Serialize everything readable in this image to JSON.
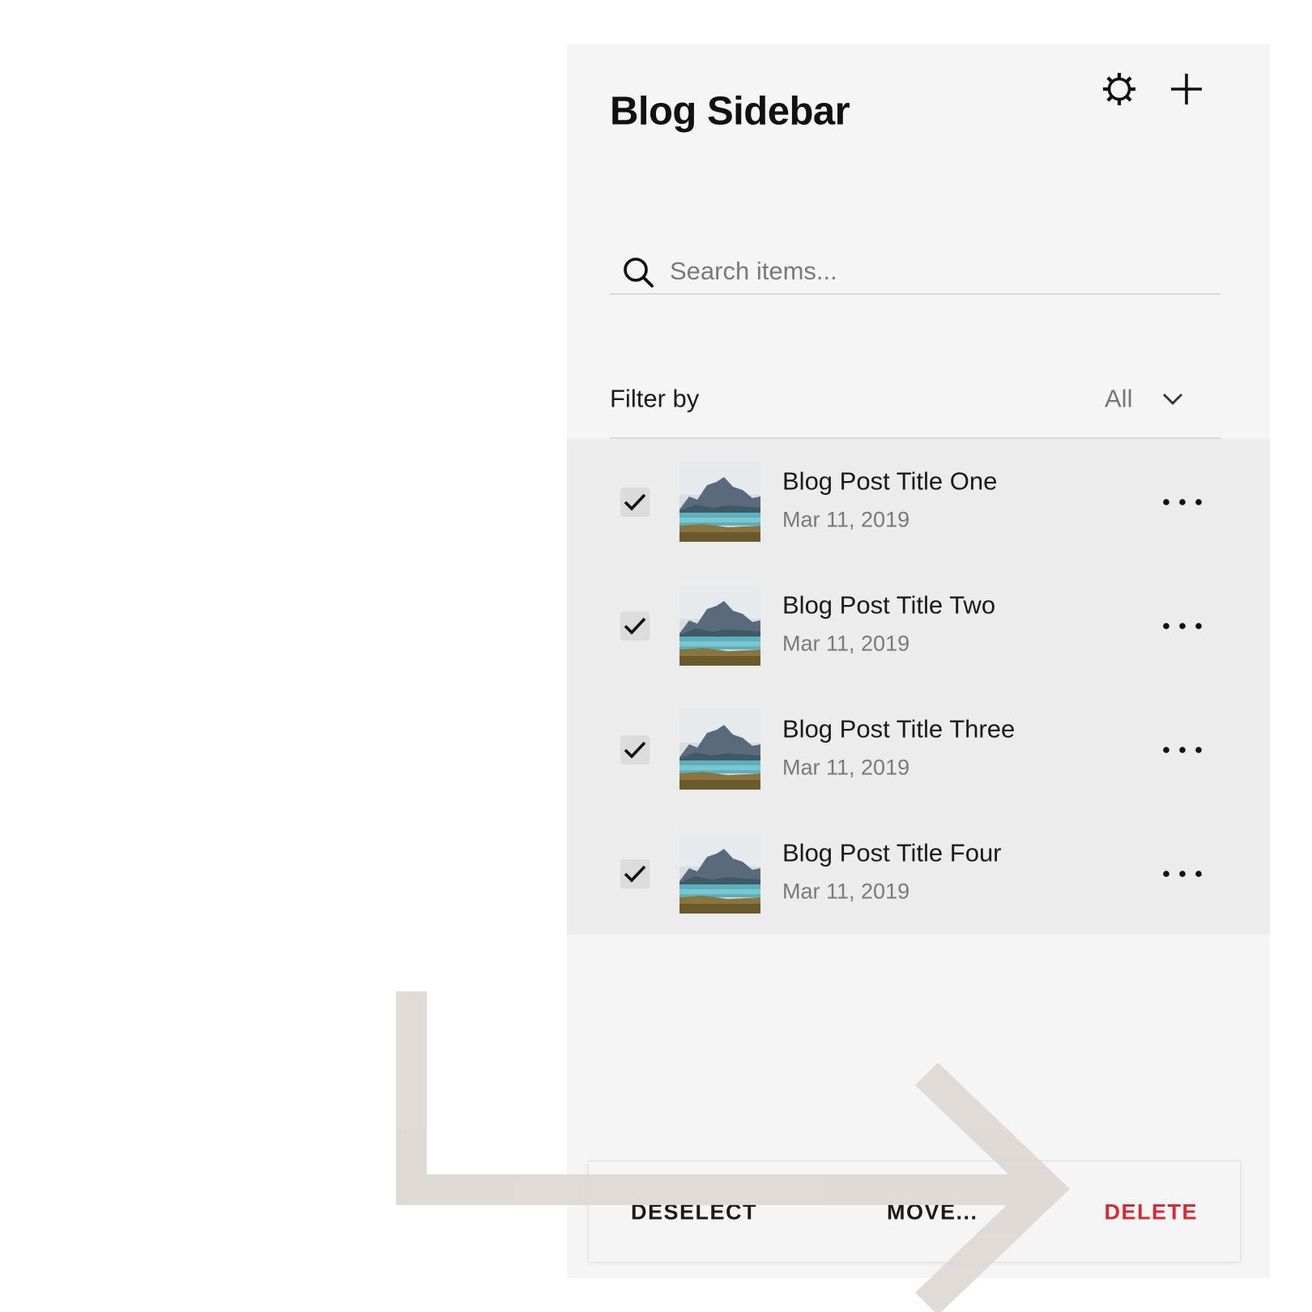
{
  "panel": {
    "title": "Blog Sidebar",
    "settings_icon": "gear-icon",
    "add_icon": "plus-icon"
  },
  "search": {
    "placeholder": "Search items...",
    "value": "",
    "icon": "search-icon"
  },
  "filter": {
    "label": "Filter by",
    "selected": "All",
    "icon": "chevron-down-icon"
  },
  "items": [
    {
      "title": "Blog Post Title One",
      "date": "Mar 11, 2019",
      "checked": true
    },
    {
      "title": "Blog Post Title Two",
      "date": "Mar 11, 2019",
      "checked": true
    },
    {
      "title": "Blog Post Title Three",
      "date": "Mar 11, 2019",
      "checked": true
    },
    {
      "title": "Blog Post Title Four",
      "date": "Mar 11, 2019",
      "checked": true
    }
  ],
  "actions": {
    "deselect": "DESELECT",
    "move": "MOVE...",
    "delete": "DELETE"
  },
  "colors": {
    "panel_background": "#f5f5f5",
    "selected_list_background": "#ececec",
    "delete_red": "#d52b36",
    "annotation_arrow": "#ded8d4"
  }
}
